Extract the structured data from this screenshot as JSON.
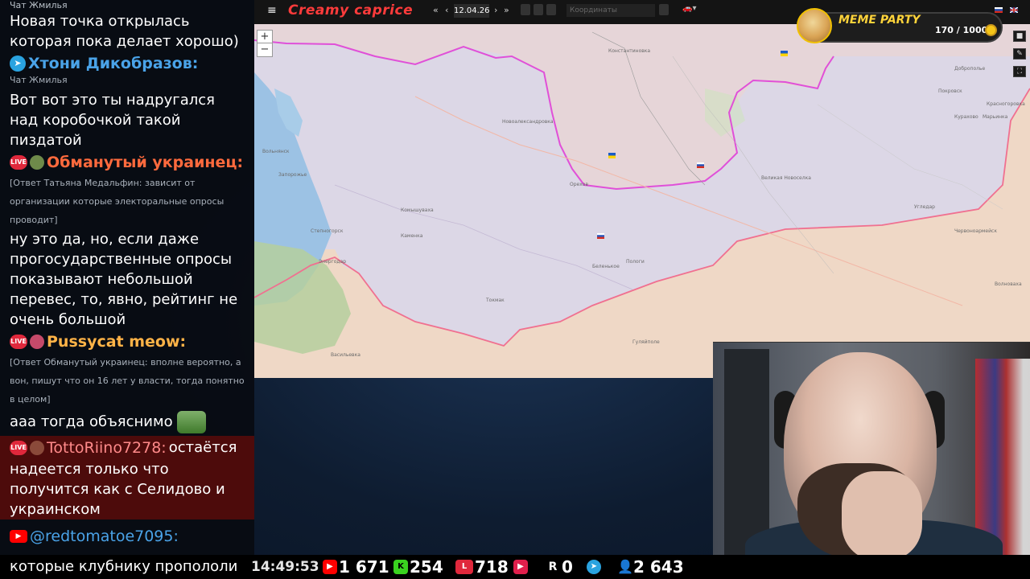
{
  "chat": {
    "top_meta": "Чат Жмилья",
    "msg1_text": "Новая точка открылась которая пока делает хорошо)",
    "user2": {
      "name": "Хтони Дикобразов:",
      "meta": "Чат Жмилья",
      "text": "Вот вот это ты надругался над коробочкой такой пиздатой",
      "color": "#4aa3e8"
    },
    "user3": {
      "name": "Обманутый украинец:",
      "reply": "[Ответ Татьяна Медальфин: зависит от организации которые электоральные опросы проводит]",
      "text": "ну это да, но, если даже прогосударственные опросы показывают небольшой перевес, то, явно, рейтинг не очень большой",
      "color": "#ff6a3d"
    },
    "user4": {
      "name": "Pussycat meow:",
      "reply": "[Ответ Обманутый украинец: вполне вероятно, а вон, пишут что он 16 лет у власти, тогда понятно в целом]",
      "text": "ааа тогда объяснимо",
      "color": "#ffb347"
    },
    "user5": {
      "name": "TottoRiino7278:",
      "text_inline": "остаётся",
      "text": "надеется только что получится как с Селидово и украинском",
      "color": "#ff8a8a"
    },
    "user6": {
      "name": "@redtomatoe7095:",
      "text": "которые клубнику пропололи",
      "color": "#4aa3e8"
    },
    "live_badge": "LIVE"
  },
  "toolbar": {
    "menu_icon": "≡",
    "brand": "Creamy caprice",
    "nav_first": "«",
    "nav_prev": "‹",
    "date": "12.04.26",
    "nav_next": "›",
    "nav_last": "»",
    "coords_placeholder": "Координаты",
    "dropdown": "▾"
  },
  "map": {
    "zoom_in": "+",
    "zoom_out": "−",
    "labels": [
      "Запорожье",
      "Васильевка",
      "Каменка",
      "Токмак",
      "Гуляйполе",
      "Орехов",
      "Комышуваха",
      "Пологи",
      "Вольнянск",
      "Степногорск",
      "Энергодар",
      "Беленькое",
      "Новоалександровка",
      "Великая Новоселка",
      "Угледар",
      "Марьинка",
      "Покровск",
      "Курахово",
      "Доброполье",
      "Червоноармейск",
      "Константиновка",
      "Красногоровка",
      "Волноваха"
    ],
    "colors": {
      "ukraine_area": "#dbd7e4",
      "occupied_area": "#f1d6c4",
      "front_line": "#e8527a",
      "contested_line": "#e050d8",
      "river": "#8fb4e0"
    }
  },
  "meme_widget": {
    "title": "MEME PARTY",
    "progress": "170 / 1000"
  },
  "stats": {
    "time": "14:49:53",
    "youtube": "1 671",
    "kick": "254",
    "vk": "718",
    "rutube": "0",
    "telegram": "2 643",
    "extra": "R",
    "r_val": "0"
  },
  "icons": {
    "menu": "hamburger-icon",
    "telegram": "telegram-icon",
    "youtube": "youtube-icon",
    "kick": "kick-icon",
    "live": "live-badge-icon",
    "coin": "coin-icon",
    "user": "user-icon"
  }
}
